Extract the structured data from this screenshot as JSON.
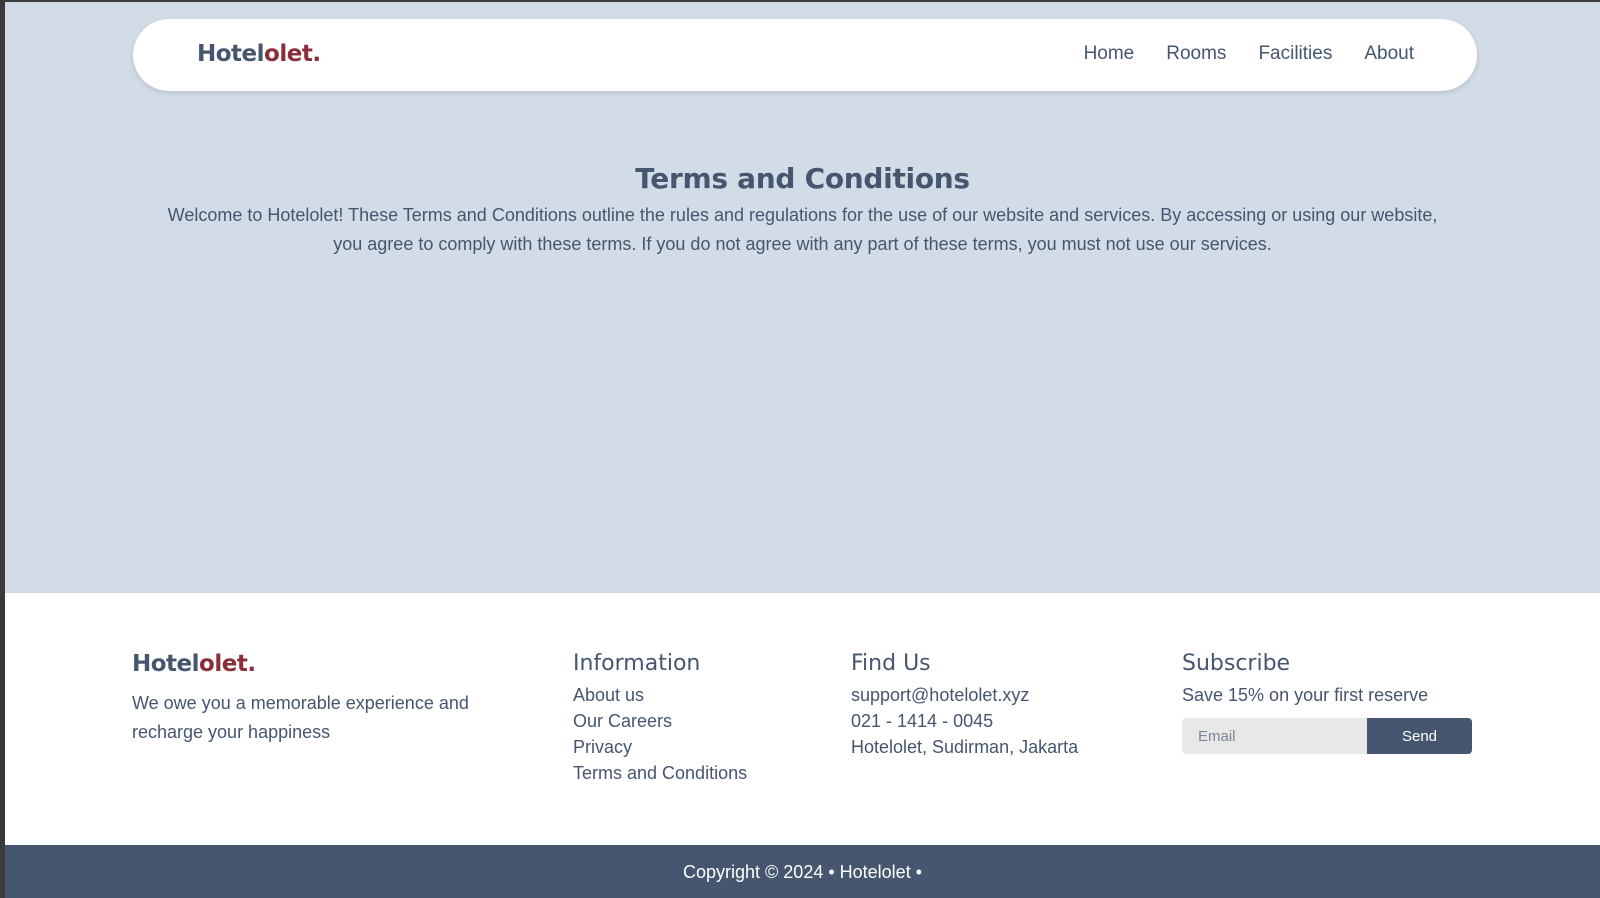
{
  "brand": {
    "name_main": "Hotel",
    "name_accent": "olet",
    "name_dot": "."
  },
  "nav": {
    "links": [
      "Home",
      "Rooms",
      "Facilities",
      "About"
    ]
  },
  "main": {
    "title": "Terms and Conditions",
    "intro": "Welcome to Hotelolet! These Terms and Conditions outline the rules and regulations for the use of our website and services. By accessing or using our website, you agree to comply with these terms. If you do not agree with any part of these terms, you must not use our services."
  },
  "footer": {
    "tagline": "We owe you a memorable experience and recharge your happiness",
    "information": {
      "title": "Information",
      "items": [
        "About us",
        "Our Careers",
        "Privacy",
        "Terms and Conditions"
      ]
    },
    "find_us": {
      "title": "Find Us",
      "items": [
        "support@hotelolet.xyz",
        "021 - 1414 - 0045",
        "Hotelolet, Sudirman, Jakarta"
      ]
    },
    "subscribe": {
      "title": "Subscribe",
      "text": "Save 15% on your first reserve",
      "email_placeholder": "Email",
      "send_label": "Send"
    },
    "copyright": "Copyright © 2024 • Hotelolet •"
  },
  "colors": {
    "primary": "#45566e",
    "accent": "#8a2f3a",
    "background": "#d2dce6"
  }
}
